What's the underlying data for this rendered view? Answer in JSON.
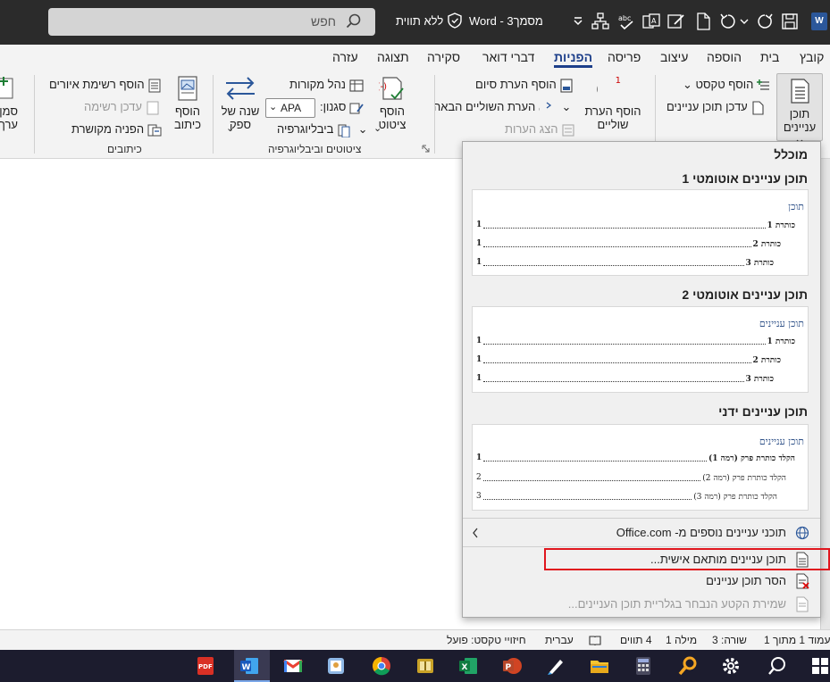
{
  "titlebar": {
    "search_placeholder": "חפש",
    "sensitivity": "ללא תווית",
    "document_title": "מסמך3 - Word",
    "app_badge": "W"
  },
  "tabs": [
    "קובץ",
    "בית",
    "הוספה",
    "עיצוב",
    "פריסה",
    "הפניות",
    "דברי דואר",
    "סקירה",
    "תצוגה",
    "עזרה"
  ],
  "active_tab": "הפניות",
  "ribbon": {
    "toc": {
      "big_button": "תוכן עניינים",
      "add_text": "הוסף טקסט",
      "update_toc": "עדכן תוכן עניינים"
    },
    "footnotes": {
      "big_button": "הוסף הערת שוליים",
      "big_icon_text": "ab",
      "insert_endnote": "הוסף הערת סיום",
      "next_footnote": "הערת השוליים הבאה",
      "show_notes": "הצג הערות"
    },
    "citations": {
      "insert_citation": "הוסף ציטוט",
      "manage_sources": "נהל מקורות",
      "style_label": "סגנון:",
      "style_value": "APA",
      "bibliography": "ביבליוגרפיה",
      "group_label": "ציטוטים וביבליוגרפיה"
    },
    "captions": {
      "smart_lookup": "שנה של ספק",
      "insert_caption": "הוסף כיתוב",
      "insert_table_of_figures": "הוסף רשימת איורים",
      "update_table": "עדכן רשימה",
      "cross_reference": "הפניה מקושרת",
      "group_label": "כיתובים"
    },
    "index": {
      "mark_entry": "סמן ערך"
    }
  },
  "gallery": {
    "builtin_header": "מוכלל",
    "items": [
      {
        "name": "תוכן עניינים אוטומטי 1",
        "preview_title": "תוכן",
        "lines": [
          {
            "label": "כותרת 1",
            "num": "1"
          },
          {
            "label": "כותרת 2",
            "num": "1"
          },
          {
            "label": "כותרת 3",
            "num": "1"
          }
        ]
      },
      {
        "name": "תוכן עניינים אוטומטי 2",
        "preview_title": "תוכן עניינים",
        "lines": [
          {
            "label": "כותרת 1",
            "num": "1"
          },
          {
            "label": "כותרת 2",
            "num": "1"
          },
          {
            "label": "כותרת 3",
            "num": "1"
          }
        ]
      },
      {
        "name": "תוכן עניינים ידני",
        "preview_title": "תוכן עניינים",
        "lines": [
          {
            "label": "הקלד כותרת פרק (רמה 1)",
            "num": "1"
          },
          {
            "label": "הקלד כותרת פרק (רמה 2)",
            "num": "2"
          },
          {
            "label": "הקלד כותרת פרק (רמה 3)",
            "num": "3"
          }
        ]
      }
    ],
    "menu": {
      "more_from_office": "תוכני עניינים נוספים מ- Office.com",
      "custom_toc": "תוכן עניינים מותאם אישית...",
      "remove_toc": "הסר תוכן עניינים",
      "save_selection": "שמירת הקטע הנבחר בגלריית תוכן העניינים..."
    }
  },
  "statusbar": {
    "page": "עמוד 1 מתוך 1",
    "line": "שורה: 3",
    "words": "מילה 1",
    "chars": "4 תווים",
    "language": "עברית",
    "text_prediction": "חיזויי טקסט: פועל"
  },
  "colors": {
    "accent": "#1d3f8a",
    "titlebar_bg": "#2b2b2b",
    "highlight": "#e0161e"
  }
}
